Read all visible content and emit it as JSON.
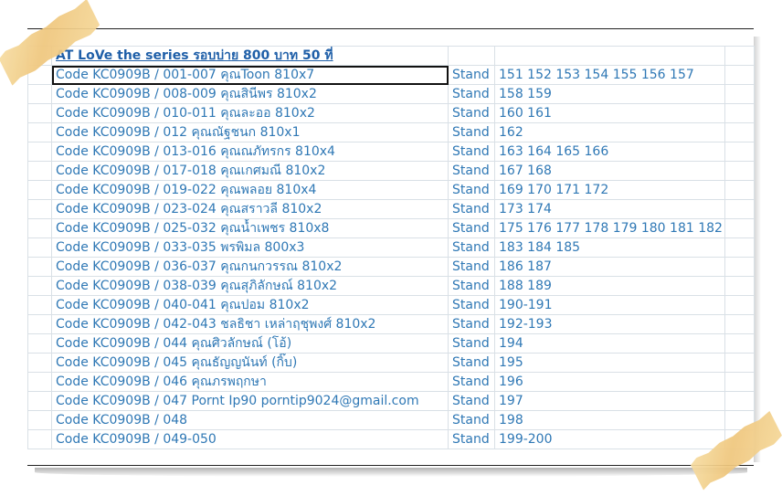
{
  "title": "AT LoVe the series รอบบ่าย 800 บาท 50 ที่",
  "rows": [
    {
      "code": "Code KC0909B / 001-007 คุณToon 810x7",
      "stand": "Stand",
      "seats": "151 152 153 154 155 156 157"
    },
    {
      "code": "Code KC0909B / 008-009 คุณสินีพร  810x2",
      "stand": "Stand",
      "seats": "158 159"
    },
    {
      "code": "Code KC0909B / 010-011 คุณละออ  810x2",
      "stand": "Stand",
      "seats": "160 161"
    },
    {
      "code": "Code KC0909B / 012 คุณณัฐชนก  810x1",
      "stand": "Stand",
      "seats": "162"
    },
    {
      "code": "Code KC0909B / 013-016 คุณณภัทรกร  810x4",
      "stand": "Stand",
      "seats": "163 164 165 166"
    },
    {
      "code": "Code KC0909B / 017-018 คุณเกศมณี  810x2",
      "stand": "Stand",
      "seats": "167 168"
    },
    {
      "code": "Code KC0909B / 019-022 คุณพลอย  810x4",
      "stand": "Stand",
      "seats": "169 170 171 172"
    },
    {
      "code": "Code KC0909B / 023-024 คุณสราวลี  810x2",
      "stand": "Stand",
      "seats": "173 174"
    },
    {
      "code": "Code KC0909B / 025-032 คุณน้ำเพชร  810x8",
      "stand": "Stand",
      "seats": "175 176 177 178 179 180 181 182"
    },
    {
      "code": "Code KC0909B / 033-035 พรพิมล  800x3",
      "stand": "Stand",
      "seats": "183 184 185"
    },
    {
      "code": "Code KC0909B / 036-037 คุณกนกวรรณ  810x2",
      "stand": "Stand",
      "seats": "186 187"
    },
    {
      "code": "Code KC0909B / 038-039 คุณสุภิลักษณ์  810x2",
      "stand": "Stand",
      "seats": "188 189"
    },
    {
      "code": "Code KC0909B / 040-041 คุณปอม  810x2",
      "stand": "Stand",
      "seats": "190-191"
    },
    {
      "code": "Code KC0909B / 042-043 ชลธิชา  เหล่าฤชุพงศ์  810x2",
      "stand": "Stand",
      "seats": "192-193"
    },
    {
      "code": "Code KC0909B / 044  คุณศิวลักษณ์  (โอ้)",
      "stand": "Stand",
      "seats": "194"
    },
    {
      "code": "Code KC0909B / 045  คุณธัญญนันท์  (กิ๊บ)",
      "stand": "Stand",
      "seats": "195"
    },
    {
      "code": "Code KC0909B / 046 คุณภรพฤกษา",
      "stand": "Stand",
      "seats": "196"
    },
    {
      "code": "Code KC0909B / 047 Pornt Ip90 porntip9024@gmail.com",
      "stand": "Stand",
      "seats": "197"
    },
    {
      "code": "Code KC0909B / 048",
      "stand": "Stand",
      "seats": "198"
    },
    {
      "code": "Code KC0909B / 049-050",
      "stand": "Stand",
      "seats": "199-200"
    }
  ]
}
